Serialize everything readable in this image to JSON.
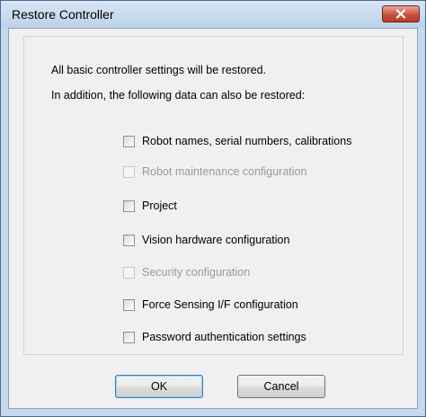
{
  "window": {
    "title": "Restore Controller"
  },
  "info": {
    "line1": "All basic controller settings will be restored.",
    "line2": "In addition, the following data can also be restored:"
  },
  "options": [
    {
      "label": "Robot names, serial numbers, calibrations",
      "checked": false,
      "enabled": true
    },
    {
      "label": "Robot maintenance configuration",
      "checked": false,
      "enabled": false
    },
    {
      "label": "Project",
      "checked": false,
      "enabled": true
    },
    {
      "label": "Vision hardware configuration",
      "checked": false,
      "enabled": true
    },
    {
      "label": "Security configuration",
      "checked": false,
      "enabled": false
    },
    {
      "label": "Force Sensing I/F configuration",
      "checked": false,
      "enabled": true
    },
    {
      "label": "Password authentication settings",
      "checked": false,
      "enabled": true
    }
  ],
  "buttons": {
    "ok": "OK",
    "cancel": "Cancel"
  },
  "colors": {
    "close_button": "#c8503c",
    "title_bar": "#c5d8ee"
  }
}
